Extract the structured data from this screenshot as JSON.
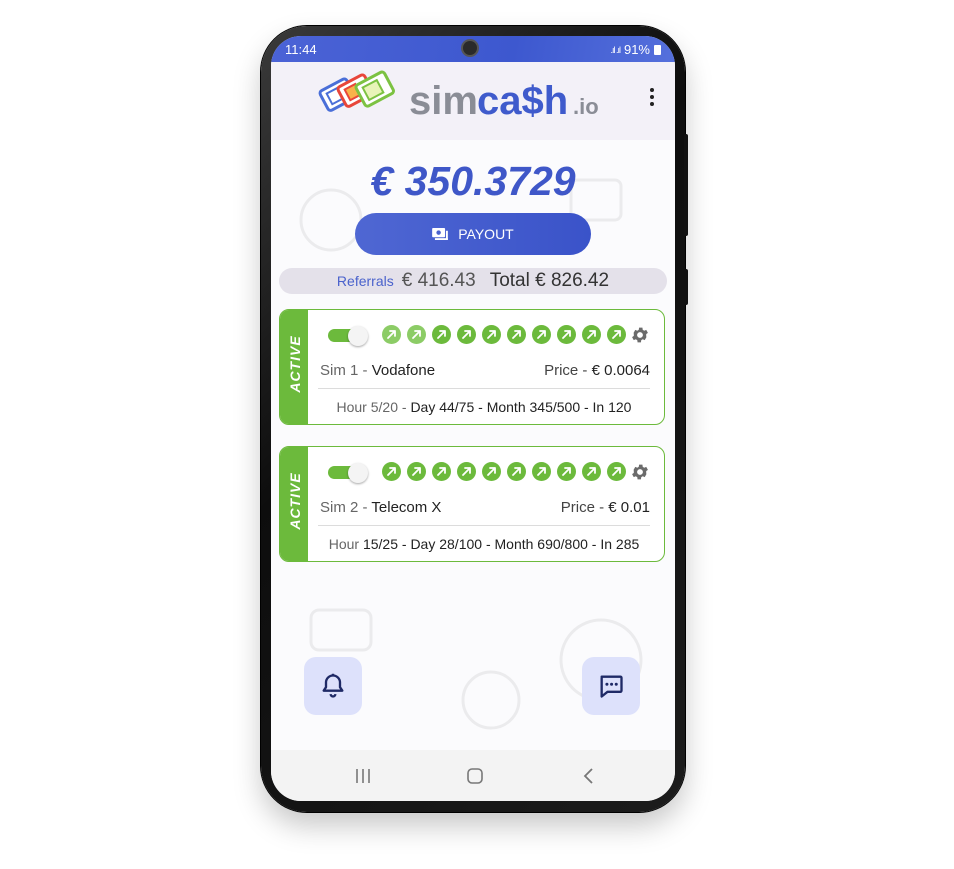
{
  "status": {
    "time": "11:44",
    "battery": "91%"
  },
  "header": {
    "logo_main": "simca$h",
    "logo_suffix": ".io",
    "menu_icon": "more-vertical-icon"
  },
  "balance": "€ 350.3729",
  "payout_label": "PAYOUT",
  "referrals": {
    "label": "Referrals",
    "amount": "€ 416.43",
    "total": "Total € 826.42"
  },
  "sims": [
    {
      "status": "ACTIVE",
      "enabled": true,
      "label": "Sim 1 - ",
      "carrier": "Vodafone",
      "price_label": "Price - ",
      "price": "€ 0.0064",
      "limits_prefix": "Hour 5/20 - ",
      "limits_rest": "Day 44/75 - Month 345/500 - In 120",
      "boost_count": 10,
      "boosts_faded": 2
    },
    {
      "status": "ACTIVE",
      "enabled": true,
      "label": "Sim 2 - ",
      "carrier": "Telecom X",
      "price_label": "Price - ",
      "price": "€ 0.01",
      "limits_prefix": "Hour ",
      "limits_rest": "15/25 - Day 28/100 - Month 690/800 - In 285",
      "boost_count": 10,
      "boosts_faded": 0
    }
  ],
  "colors": {
    "accent": "#3f57c8",
    "active_green": "#6cba3c",
    "fab_bg": "#dde1fb"
  }
}
